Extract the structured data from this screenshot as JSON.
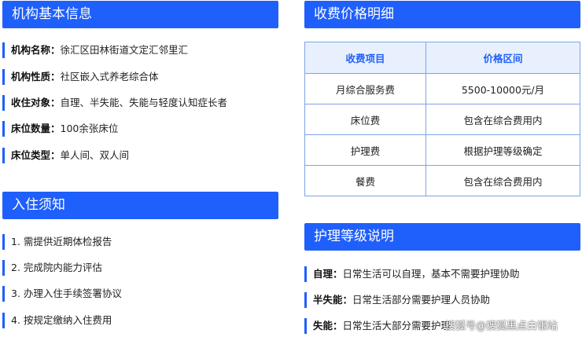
{
  "org_info": {
    "title": "机构基本信息",
    "rows": [
      {
        "label": "机构名称：",
        "value": "徐汇区田林街道文定汇邻里汇"
      },
      {
        "label": "机构性质：",
        "value": "社区嵌入式养老综合体"
      },
      {
        "label": "收住对象：",
        "value": "自理、半失能、失能与轻度认知症长者"
      },
      {
        "label": "床位数量：",
        "value": "100余张床位"
      },
      {
        "label": "床位类型：",
        "value": "单人间、双人间"
      }
    ]
  },
  "admission": {
    "title": "入住须知",
    "items": [
      "1. 需提供近期体检报告",
      "2. 完成院内能力评估",
      "3. 办理入住手续签署协议",
      "4. 按规定缴纳入住费用"
    ]
  },
  "fees": {
    "title": "收费价格明细",
    "headers": [
      "收费项目",
      "价格区间"
    ],
    "rows": [
      [
        "月综合服务费",
        "5500-10000元/月"
      ],
      [
        "床位费",
        "包含在综合费用内"
      ],
      [
        "护理费",
        "根据护理等级确定"
      ],
      [
        "餐费",
        "包含在综合费用内"
      ]
    ]
  },
  "care_levels": {
    "title": "护理等级说明",
    "rows": [
      {
        "label": "自理：",
        "value": "日常生活可以自理，基本不需要护理协助"
      },
      {
        "label": "半失能：",
        "value": "日常生活部分需要护理人员协助"
      },
      {
        "label": "失能：",
        "value": "日常生活大部分需要护理"
      }
    ]
  },
  "watermark": "搜狐号@搜狐黑点白银站",
  "colors": {
    "accent": "#1f5ffb",
    "table_header_bg": "#e8f0fe",
    "table_border": "#7fa4e6"
  }
}
